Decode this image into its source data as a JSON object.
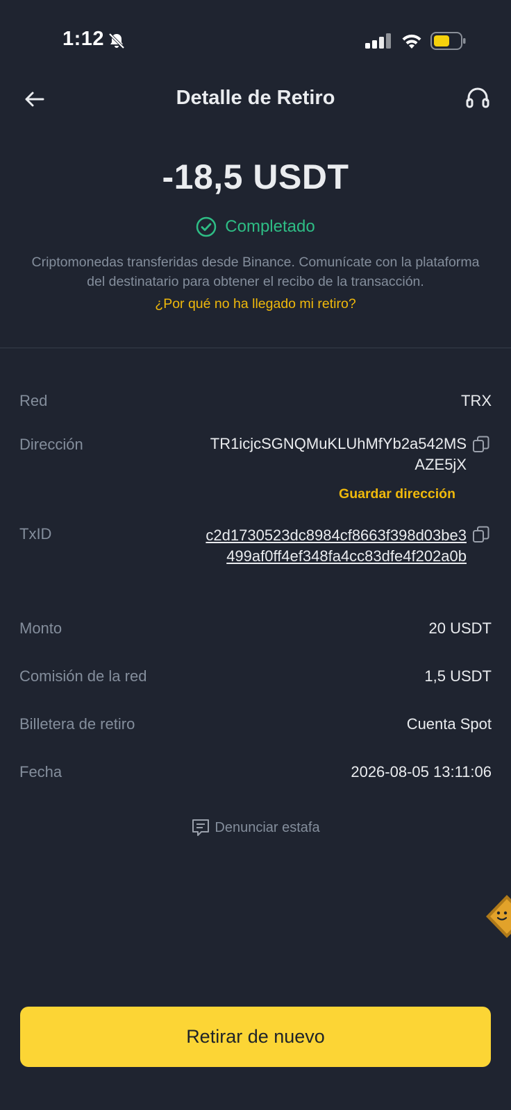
{
  "status_bar": {
    "time": "1:12"
  },
  "header": {
    "title": "Detalle de Retiro"
  },
  "summary": {
    "amount": "-18,5 USDT",
    "status": "Completado",
    "status_color": "#2ebd85",
    "description": "Criptomonedas transferidas desde Binance. Comunícate con la plataforma del destinatario para obtener el recibo de la transacción.",
    "help_link": "¿Por qué no ha llegado mi retiro?"
  },
  "details": {
    "network": {
      "label": "Red",
      "value": "TRX"
    },
    "address": {
      "label": "Dirección",
      "value": "TR1icjcSGNQMuKLUhMfYb2a542MSAZE5jX",
      "save_label": "Guardar dirección"
    },
    "txid": {
      "label": "TxID",
      "value": "c2d1730523dc8984cf8663f398d03be3499af0ff4ef348fa4cc83dfe4f202a0b"
    },
    "amount": {
      "label": "Monto",
      "value": "20 USDT"
    },
    "fee": {
      "label": "Comisión de la red",
      "value": "1,5 USDT"
    },
    "wallet": {
      "label": "Billetera de retiro",
      "value": "Cuenta Spot"
    },
    "date": {
      "label": "Fecha",
      "value": "2026-08-05 13:11:06"
    }
  },
  "report": {
    "label": "Denunciar estafa"
  },
  "cta": {
    "label": "Retirar de nuevo"
  },
  "colors": {
    "background": "#1f2430",
    "accent": "#f0b90b",
    "button": "#fcd535",
    "muted_text": "#848e9c"
  },
  "icons": {
    "back": "arrow-left-icon",
    "support": "headset-icon",
    "status": "check-circle-icon",
    "copy": "copy-icon",
    "report": "report-icon"
  }
}
